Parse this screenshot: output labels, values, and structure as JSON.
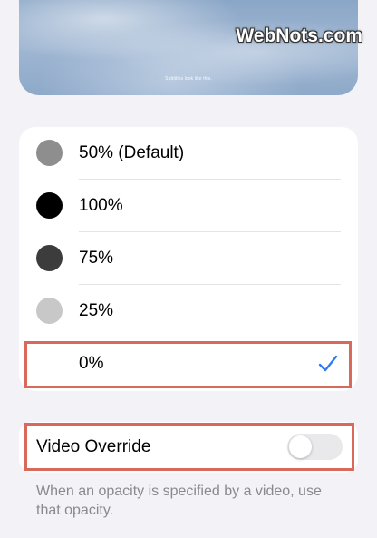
{
  "preview": {
    "subtitle_text": "Subtitles look like this."
  },
  "watermark": {
    "text": "WebNots.com"
  },
  "options": [
    {
      "label": "50% (Default)",
      "swatch_color": "#8e8e8e",
      "selected": false
    },
    {
      "label": "100%",
      "swatch_color": "#000000",
      "selected": false
    },
    {
      "label": "75%",
      "swatch_color": "#3c3c3c",
      "selected": false
    },
    {
      "label": "25%",
      "swatch_color": "#c8c8c8",
      "selected": false
    },
    {
      "label": "0%",
      "swatch_color": null,
      "selected": true
    }
  ],
  "video_override": {
    "label": "Video Override",
    "enabled": false
  },
  "footnote": {
    "text": "When an opacity is specified by a video, use that opacity."
  },
  "colors": {
    "accent": "#2f7cf6",
    "highlight": "#d9695b",
    "background": "#f2f2f7",
    "secondary_text": "#8a8a8e"
  },
  "icons": {
    "selected_marker": "checkmark-icon"
  }
}
